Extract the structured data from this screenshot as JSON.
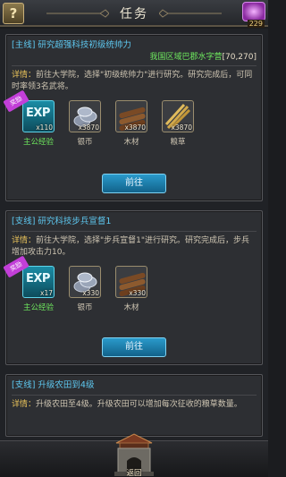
{
  "header": {
    "title": "任务",
    "help_label": "?",
    "gem_count": "229"
  },
  "quests": [
    {
      "title": "[主线] 研究超强科技初级统帅力",
      "subline_text": "我国区域巴郡水字营",
      "subline_coord": "[70,270]",
      "desc_label": "详情：",
      "desc": "前往大学院，选择\"初级统帅力\"进行研究。研究完成后，可同时率领3名武将。",
      "rewards_tag": "奖励",
      "rewards": [
        {
          "icon": "exp-icon",
          "text": "EXP",
          "qty": "x110",
          "label": "主公经验"
        },
        {
          "icon": "silver-coin-icon",
          "qty": "x3870",
          "label": "银币"
        },
        {
          "icon": "wood-icon",
          "qty": "x3870",
          "label": "木材"
        },
        {
          "icon": "grain-icon",
          "qty": "x3870",
          "label": "粮草"
        }
      ],
      "button": "前往"
    },
    {
      "title": "[支线] 研究科技步兵宣督1",
      "desc_label": "详情：",
      "desc": "前往大学院，选择\"步兵宣督1\"进行研究。研究完成后，步兵增加攻击力10。",
      "rewards_tag": "奖励",
      "rewards": [
        {
          "icon": "exp-icon",
          "text": "EXP",
          "qty": "x17",
          "label": "主公经验"
        },
        {
          "icon": "silver-coin-icon",
          "qty": "x330",
          "label": "银币"
        },
        {
          "icon": "wood-icon",
          "qty": "x330",
          "label": "木材"
        }
      ],
      "button": "前往"
    },
    {
      "title": "[支线] 升级农田到4级",
      "desc_label": "详情：",
      "desc": "升级农田至4级。升级农田可以增加每次征收的粮草数量。"
    }
  ],
  "footer": {
    "back_label": "返回"
  },
  "colors": {
    "quest_title": "#5ec8f0",
    "highlight_green": "#6ee85e",
    "button_blue": "#2a9acb",
    "reward_tag": "#c23fd8"
  }
}
